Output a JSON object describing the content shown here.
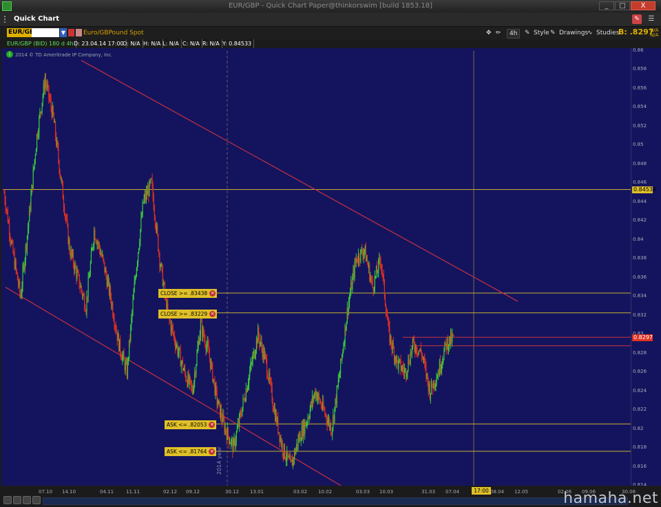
{
  "window": {
    "title": "EUR/GBP - Quick Chart Paper@thinkorswim [build 1853.18]",
    "icon": "thinkorswim-logo-icon",
    "minimize": "_",
    "maximize": "□",
    "close": "X"
  },
  "quickchart": {
    "label": "Quick Chart"
  },
  "toolbar": {
    "symbol": "EUR/GBP",
    "description": "Euro/GBPound Spot",
    "timeframe": "4h",
    "style_label": "Style",
    "drawings_label": "Drawings",
    "studies_label": "Studies",
    "bid_label": "B: .8297",
    "na1": "N/A",
    "na2": "N/A"
  },
  "infobar": {
    "symbol": "EUR/GBP (BID) 180 d 4h",
    "date": "D: 23.04.14 17:00",
    "open": "O: N/A",
    "high": "H: N/A",
    "low": "L: N/A",
    "close": "C: N/A",
    "range": "R: N/A",
    "y": "Y: 0.84533"
  },
  "copyright": "2014 © TD Ameritrade IP Company, Inc.",
  "alerts": [
    {
      "label": "CLOSE >= .83438",
      "price": 0.83438
    },
    {
      "label": "CLOSE >= .83229",
      "price": 0.83229
    },
    {
      "label": "ASK <= .82053",
      "price": 0.82053
    },
    {
      "label": "ASK <= .81764",
      "price": 0.81764
    }
  ],
  "price_tags": {
    "cursor": "0.84533",
    "last": "0.8297"
  },
  "time_badge": "17:00",
  "year_marker": "2014 year",
  "watermark": "hamaha.net",
  "colors": {
    "background": "#14145e",
    "bull": "#3cc83c",
    "bear": "#e03020",
    "trendline": "#c83040",
    "alertline": "#c8b030"
  },
  "chart_data": {
    "type": "candlestick",
    "symbol": "EUR/GBP",
    "aggregation": "4h",
    "ylim": [
      0.814,
      0.86
    ],
    "y_ticks": [
      "0.86",
      "0.858",
      "0.856",
      "0.854",
      "0.852",
      "0.85",
      "0.848",
      "0.846",
      "0.844",
      "0.842",
      "0.84",
      "0.838",
      "0.836",
      "0.834",
      "0.832",
      "0.83",
      "0.828",
      "0.826",
      "0.824",
      "0.822",
      "0.82",
      "0.818",
      "0.816",
      "0.814"
    ],
    "x_ticks": [
      "07.10",
      "14.10",
      "04.11",
      "11.11",
      "02.12",
      "09.12",
      "30.12",
      "13.01",
      "03.02",
      "10.02",
      "03.03",
      "10.03",
      "31.03",
      "07.04",
      "08.04",
      "12.05",
      "02.06",
      "09.06",
      "30.06"
    ],
    "approx_close_path": [
      0.845,
      0.839,
      0.834,
      0.842,
      0.851,
      0.857,
      0.853,
      0.846,
      0.839,
      0.836,
      0.833,
      0.841,
      0.838,
      0.834,
      0.829,
      0.826,
      0.836,
      0.844,
      0.846,
      0.838,
      0.832,
      0.829,
      0.826,
      0.824,
      0.831,
      0.828,
      0.823,
      0.82,
      0.818,
      0.822,
      0.826,
      0.83,
      0.827,
      0.822,
      0.818,
      0.816,
      0.819,
      0.821,
      0.824,
      0.822,
      0.82,
      0.826,
      0.833,
      0.838,
      0.839,
      0.835,
      0.838,
      0.83,
      0.827,
      0.826,
      0.829,
      0.828,
      0.824,
      0.826,
      0.829,
      0.8297
    ],
    "trendlines": [
      {
        "from": 0.859,
        "to": 0.8335,
        "name": "upper-channel"
      },
      {
        "from": 0.835,
        "to": 0.8125,
        "name": "lower-channel"
      }
    ],
    "hlines": [
      0.84533,
      0.83438,
      0.83229,
      0.8297,
      0.8288,
      0.82053,
      0.81764
    ],
    "legend": "none",
    "grid": false
  }
}
